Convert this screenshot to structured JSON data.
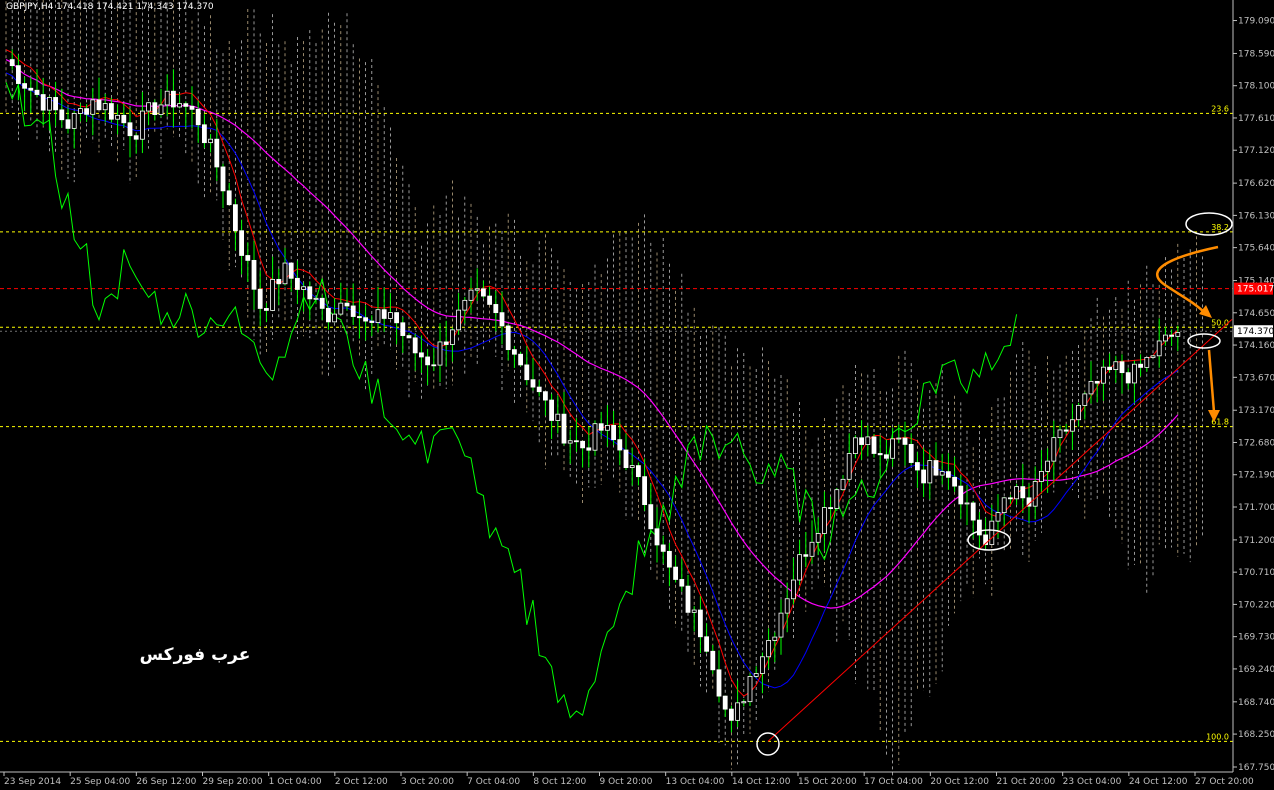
{
  "header": {
    "title": "GBPJPY,H4  174.418 174.421 174.343 174.370"
  },
  "watermark": "عرب فوركس",
  "colors": {
    "background": "#000000",
    "candle": "#ffffff",
    "price_grid": "#c0c0c0",
    "tenkan": "#ff0000",
    "kijun": "#0000ff",
    "chikou": "#00ff00",
    "ma": "#ff00ff",
    "cloud_up": "#ffe4b5",
    "cloud_down": "#ffffff",
    "fib": "#ffff00",
    "resistance": "#ff0000",
    "trendline": "#ff0000",
    "annotation_arrow": "#ff8c00",
    "annotation_ellipse": "#ffffff"
  },
  "chart_data": {
    "type": "candlestick",
    "symbol": "GBPJPY",
    "timeframe": "H4",
    "ohlc_header": {
      "open": 174.418,
      "high": 174.421,
      "low": 174.343,
      "close": 174.37
    },
    "ylim": [
      167.75,
      179.25
    ],
    "y_ticks": [
      "179.090",
      "178.590",
      "178.100",
      "177.610",
      "177.120",
      "176.620",
      "176.130",
      "175.640",
      "175.140",
      "174.650",
      "174.160",
      "173.670",
      "173.170",
      "172.680",
      "172.190",
      "171.700",
      "171.200",
      "170.710",
      "170.220",
      "169.730",
      "169.240",
      "168.740",
      "168.250",
      "167.750"
    ],
    "x_ticks": [
      "23 Sep 2014",
      "25 Sep 04:00",
      "26 Sep 12:00",
      "29 Sep 20:00",
      "1 Oct 04:00",
      "2 Oct 12:00",
      "3 Oct 20:00",
      "7 Oct 04:00",
      "8 Oct 12:00",
      "9 Oct 20:00",
      "13 Oct 04:00",
      "14 Oct 12:00",
      "15 Oct 20:00",
      "17 Oct 04:00",
      "20 Oct 12:00",
      "21 Oct 20:00",
      "23 Oct 04:00",
      "24 Oct 12:00",
      "27 Oct 20:00"
    ],
    "current_price": {
      "value": 174.37,
      "label": "174.370"
    },
    "resistance_line": {
      "value": 175.017,
      "label": "175.017"
    },
    "fib_levels": [
      {
        "label": "23.6",
        "value": 177.68
      },
      {
        "label": "38.2",
        "value": 175.88
      },
      {
        "label": "50.0",
        "value": 174.43
      },
      {
        "label": "61.8",
        "value": 172.92
      },
      {
        "label": "100.0",
        "value": 168.14
      }
    ],
    "trendline": {
      "from": 168.14,
      "to": 174.4
    },
    "series": [
      {
        "name": "Tenkan-sen",
        "color": "tenkan"
      },
      {
        "name": "Kijun-sen",
        "color": "kijun"
      },
      {
        "name": "Chikou span",
        "color": "chikou"
      },
      {
        "name": "Moving average",
        "color": "ma"
      },
      {
        "name": "Ichimoku cloud",
        "color": "cloud_down"
      }
    ],
    "price_path": [
      178.5,
      178.1,
      177.8,
      177.5,
      177.9,
      177.7,
      177.4,
      177.8,
      177.9,
      177.6,
      176.8,
      175.7,
      174.7,
      175.3,
      175.0,
      174.6,
      174.9,
      174.4,
      174.7,
      174.1,
      173.9,
      174.5,
      174.9,
      174.6,
      174.0,
      173.4,
      172.9,
      172.6,
      172.9,
      172.5,
      171.8,
      170.8,
      170.2,
      169.6,
      168.3,
      169.2,
      169.8,
      170.7,
      171.4,
      172.0,
      172.9,
      172.4,
      172.7,
      172.2,
      172.4,
      171.8,
      171.1,
      172.0,
      171.7,
      172.5,
      173.0,
      173.5,
      173.8,
      173.7,
      174.1,
      174.37
    ]
  }
}
